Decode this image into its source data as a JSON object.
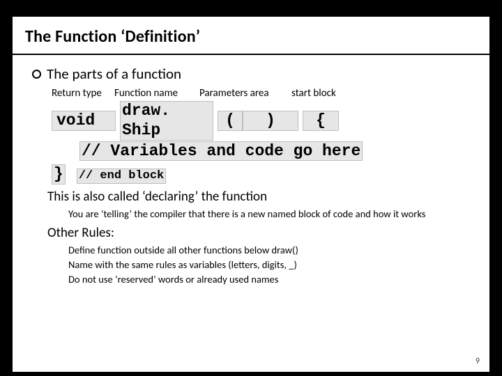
{
  "title": "The Function ‘Definition’",
  "bullet": "The parts of a function",
  "labels": {
    "return_type": "Return type",
    "function_name": "Function name",
    "parameters": "Parameters area",
    "start_block": "start block"
  },
  "code": {
    "void": "void",
    "name": "draw. Ship",
    "lparen": "(",
    "rparen": ")",
    "lbrace": "{",
    "body_comment": "// Variables and code go here",
    "rbrace": "}",
    "end_comment": "// end block"
  },
  "declaring_line": "This is also called ‘declaring’ the function",
  "declaring_sub": "You are ‘telling’ the compiler that there is a new named block of code and how it works",
  "rules_header": "Other Rules:",
  "rules": [
    "Define function outside all other functions below draw()",
    "Name with the same rules as variables (letters, digits, _)",
    "Do not use ‘reserved’ words or already used names"
  ],
  "page_number": "9"
}
